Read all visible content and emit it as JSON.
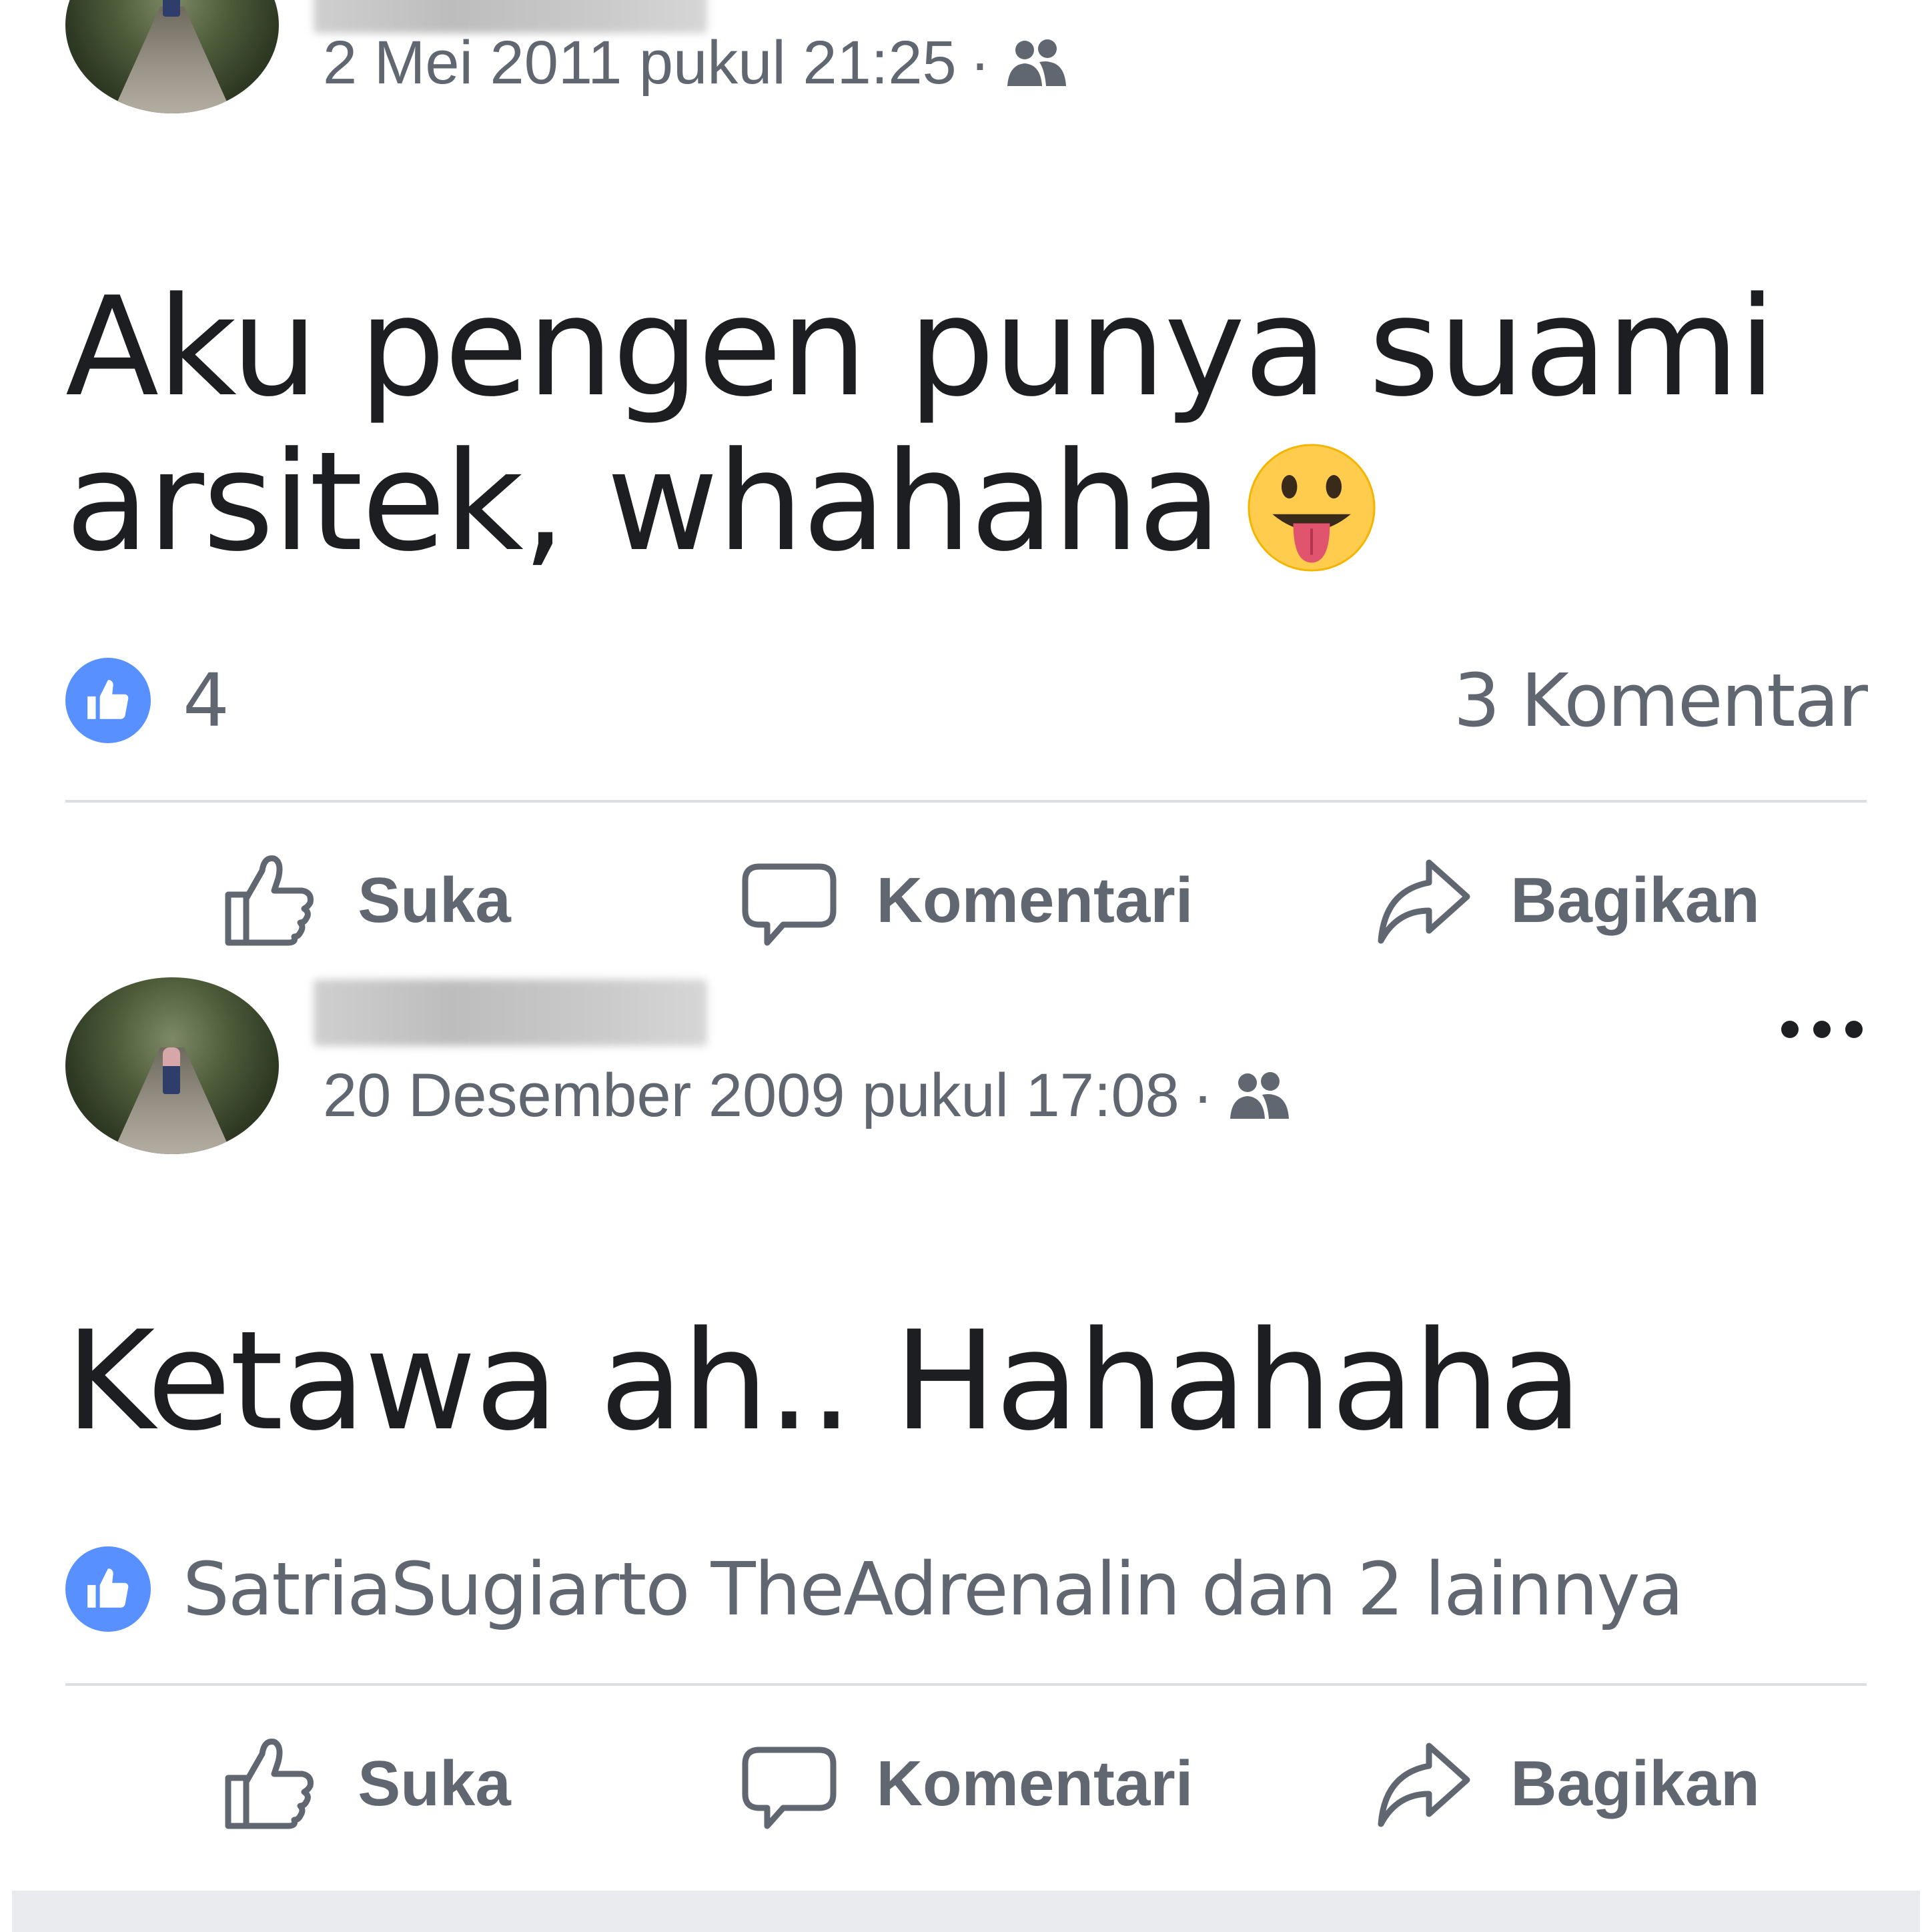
{
  "posts": [
    {
      "timestamp": "2 Mei 2011 pukul 21:25",
      "separator": "·",
      "audience_icon": "friends-icon",
      "text_line1": "Aku pengen punya suami",
      "text_line2": "arsitek, whahaha",
      "emoji": "tongue-out-emoji",
      "like_count": "4",
      "comment_count": "3 Komentar"
    },
    {
      "timestamp": "20 Desember 2009 pukul 17:08",
      "separator": "·",
      "audience_icon": "friends-icon",
      "text": "Ketawa ah.. Hahahaha",
      "likers": "SatriaSugiarto TheAdrenalin dan 2 lainnya"
    }
  ],
  "actions": {
    "like": "Suka",
    "comment": "Komentari",
    "share": "Bagikan"
  },
  "colors": {
    "like_badge": "#5890ff",
    "meta_text": "#606770",
    "post_text": "#1c1e21",
    "divider": "#dadde1",
    "emoji_face": "#ffcc4d",
    "emoji_tongue": "#e0556d"
  }
}
